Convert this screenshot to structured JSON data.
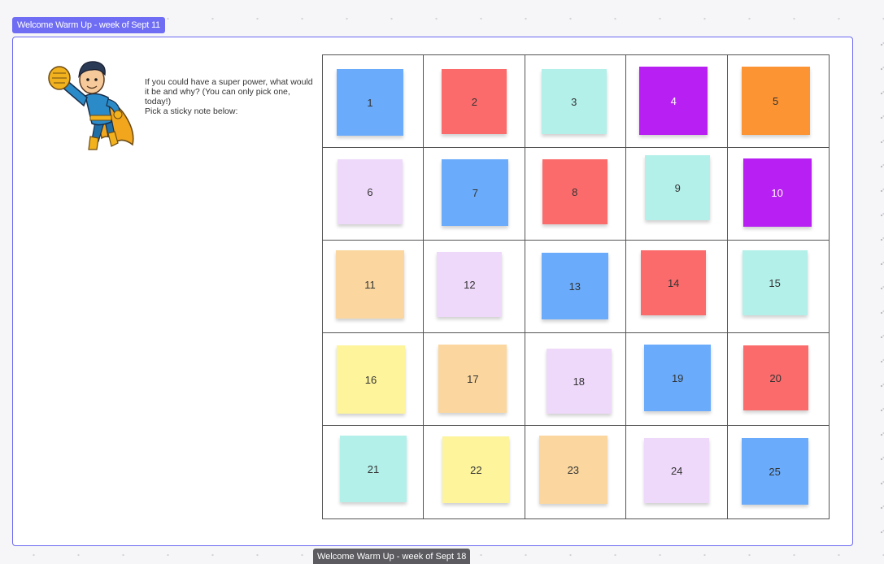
{
  "frame_title": "Welcome Warm Up - week of Sept 11",
  "next_frame_title": "Welcome Warm Up - week of Sept 18",
  "prompt": {
    "question": "If you could have a super power, what would it be and why?  (You can only pick one, today!)",
    "instruction": "Pick a sticky note below:"
  },
  "hero_image": "superhero-illustration",
  "colors": {
    "blue": "#6aacfb",
    "red": "#fb6b6b",
    "teal": "#b4f0ea",
    "purple": "#b71ff2",
    "orange": "#fc9433",
    "lavender": "#efd9fb",
    "peach": "#fbd79f",
    "yellow": "#fdf49b",
    "frame_border": "#6b68f0"
  },
  "notes": [
    {
      "label": "1",
      "color": "blue"
    },
    {
      "label": "2",
      "color": "red"
    },
    {
      "label": "3",
      "color": "teal"
    },
    {
      "label": "4",
      "color": "purple"
    },
    {
      "label": "5",
      "color": "orange"
    },
    {
      "label": "6",
      "color": "lavender"
    },
    {
      "label": "7",
      "color": "blue"
    },
    {
      "label": "8",
      "color": "red"
    },
    {
      "label": "9",
      "color": "teal"
    },
    {
      "label": "10",
      "color": "purple"
    },
    {
      "label": "11",
      "color": "peach"
    },
    {
      "label": "12",
      "color": "lavender"
    },
    {
      "label": "13",
      "color": "blue"
    },
    {
      "label": "14",
      "color": "red"
    },
    {
      "label": "15",
      "color": "teal"
    },
    {
      "label": "16",
      "color": "yellow"
    },
    {
      "label": "17",
      "color": "peach"
    },
    {
      "label": "18",
      "color": "lavender"
    },
    {
      "label": "19",
      "color": "blue"
    },
    {
      "label": "20",
      "color": "red"
    },
    {
      "label": "21",
      "color": "teal"
    },
    {
      "label": "22",
      "color": "yellow"
    },
    {
      "label": "23",
      "color": "peach"
    },
    {
      "label": "24",
      "color": "lavender"
    },
    {
      "label": "25",
      "color": "blue"
    }
  ]
}
